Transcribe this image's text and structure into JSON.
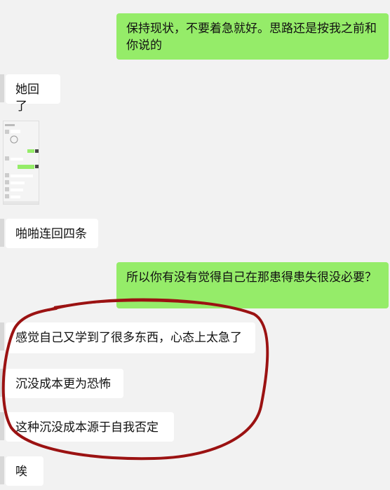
{
  "messages": [
    {
      "side": "out",
      "text": "保持现状，不要着急就好。思路还是按我之前和你说的"
    },
    {
      "side": "in",
      "text": "她回了"
    },
    {
      "side": "in",
      "type": "image",
      "content": "chat-screenshot-thumbnail"
    },
    {
      "side": "in",
      "text": "啪啪连回四条"
    },
    {
      "side": "out",
      "text": "所以你有没有觉得自己在那患得患失很没必要？"
    },
    {
      "side": "in",
      "text": "感觉自己又学到了很多东西，心态上太急了"
    },
    {
      "side": "in",
      "text": "沉没成本更为恐怖"
    },
    {
      "side": "in",
      "text": "这种沉没成本源于自我否定"
    },
    {
      "side": "in",
      "text": "唉"
    }
  ],
  "colors": {
    "background": "#f2f2f2",
    "incoming_bubble": "#ffffff",
    "outgoing_bubble": "#95ec69",
    "annotation_circle": "#9b1212"
  },
  "annotation": {
    "shape": "hand-drawn-circle",
    "encloses_messages": [
      5,
      6,
      7
    ]
  }
}
